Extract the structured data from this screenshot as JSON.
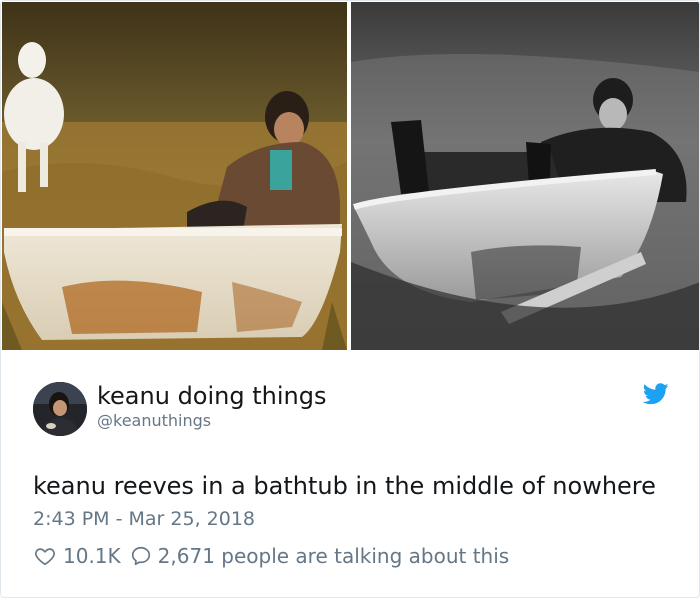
{
  "photos": {
    "left": {
      "subject": "man in jacket seated in weathered bathtub in dry grass field, white dog nearby"
    },
    "right": {
      "subject": "black and white photo of man reclining in bathtub in grass field"
    }
  },
  "tweet": {
    "display_name": "keanu doing things",
    "handle": "@keanuthings",
    "text": "keanu reeves in a bathtub in the middle of nowhere",
    "time": "2:43 PM",
    "separator": " - ",
    "date": "Mar 25, 2018",
    "likes": "10.1K",
    "conversation": "2,671 people are talking about this"
  },
  "icons": {
    "brand": "twitter-bird-icon",
    "like": "heart-icon",
    "reply": "speech-bubble-icon"
  },
  "colors": {
    "twitter_blue": "#1da1f2",
    "secondary_text": "#657786",
    "primary_text": "#14171a",
    "border": "#e1e8ed"
  }
}
